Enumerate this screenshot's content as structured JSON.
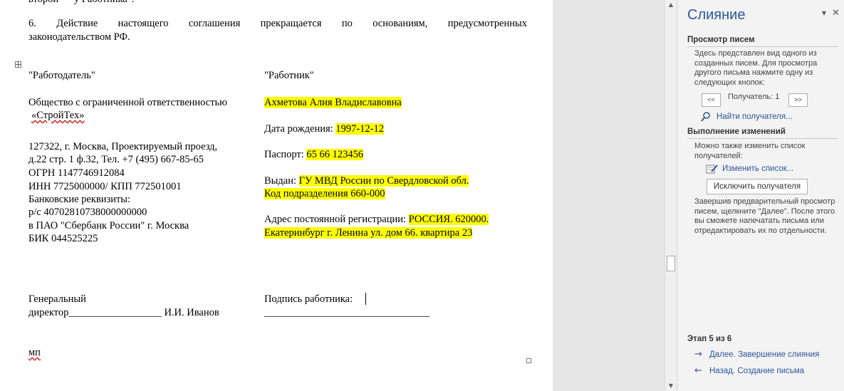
{
  "document": {
    "top_cut_line": "второй — у Работника\".",
    "clause6_words": [
      "6.",
      "Действие",
      "настоящего",
      "соглашения",
      "прекращается",
      "по",
      "основаниям,",
      "предусмотренных"
    ],
    "clause6_line2": "законодательством РФ.",
    "employer": {
      "heading": "\"Работодатель\"",
      "name_line1": "Общество с ограниченной ответственностью",
      "name_line2": "«СтройТех»",
      "address_line1": "127322, г. Москва, Проектируемый проезд,",
      "address_line2": "д.22 стр. 1 ф.32, Тел. +7 (495) 667-85-65",
      "ogrn": "ОГРН 1147746912084",
      "inn_kpp": "ИНН 7725000000/ КПП 772501001",
      "bank_details": "Банковские реквизиты:",
      "account": "р/с 40702810738000000000",
      "bank": "в ПАО \"Сбербанк России\" г. Москва",
      "bik": "БИК 044525225",
      "director_line1": "Генеральный",
      "director_line2": "директор__________________ И.И. Иванов",
      "stamp": "мп"
    },
    "employee": {
      "heading": "\"Работник\"",
      "full_name": "Ахметова Алия Владиславовна",
      "birth_label": "Дата рождения: ",
      "birth_value": "1997-12-12",
      "passport_label": "Паспорт: ",
      "passport_value": "65 66 123456",
      "issued_label": "Выдан: ",
      "issued_value": "ГУ МВД России по Свердловской обл.",
      "dept_code": "Код подразделения 660-000",
      "address_label": "Адрес постоянной регистрации: ",
      "address_value_line1": "РОССИЯ. 620000.",
      "address_value_line2": "Екатеринбург г. Ленина ул. дом 66. квартира 23",
      "signature_label": "Подпись работника: ",
      "signature_line": "________________________________"
    }
  },
  "mail_merge_pane": {
    "title": "Слияние",
    "dropdown_glyph": "▾",
    "close_glyph": "✕",
    "preview_section": "Просмотр писем",
    "preview_text": "Здесь представлен вид одного из созданных писем. Для просмотра другого письма нажмите одну из следующих кнопок:",
    "prev_button": "<<",
    "recipient_label": "Получатель: 1",
    "next_button": ">>",
    "find_recipient_link": "Найти получателя...",
    "changes_section": "Выполнение изменений",
    "changes_text": "Можно также изменить список получателей:",
    "edit_list_link": "Изменить список...",
    "exclude_button": "Исключить получателя",
    "finish_text": "Завершив предварительный просмотр писем, щелкните \"Далее\". После этого вы сможете напечатать письма или отредактировать их по отдельности.",
    "step": "Этап 5 из 6",
    "next_link": "Далее. Завершение слияния",
    "back_link": "Назад. Создание письма",
    "next_arrow": "→",
    "back_arrow": "←"
  },
  "scrollbar": {
    "up_glyph": "▲",
    "down_glyph": "▼"
  },
  "colors": {
    "highlight": "#ffff00",
    "accent": "#2b579a"
  }
}
